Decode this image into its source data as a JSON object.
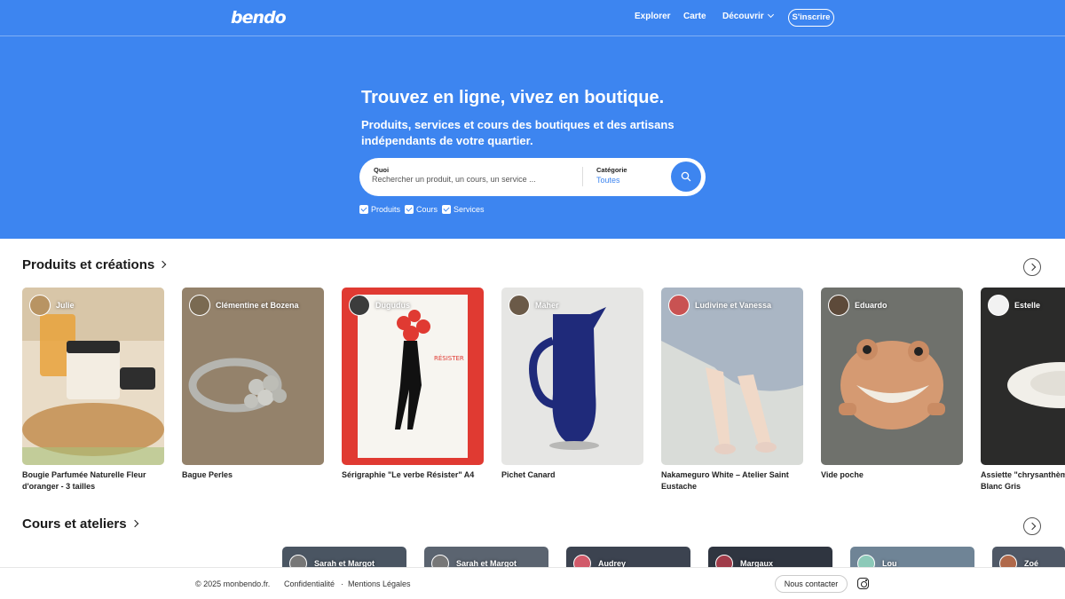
{
  "header": {
    "logo": "bendo",
    "nav": {
      "explorer": "Explorer",
      "carte": "Carte",
      "decouvrir": "Découvrir"
    },
    "signup": "S'inscrire"
  },
  "hero": {
    "title": "Trouvez en ligne, vivez en boutique.",
    "subtitle": "Produits, services et cours des boutiques et des artisans indépendants de votre quartier.",
    "search": {
      "what_label": "Quoi",
      "what_placeholder": "Rechercher un produit, un cours, un service ...",
      "category_label": "Catégorie",
      "category_value": "Toutes"
    },
    "filters": [
      {
        "label": "Produits",
        "checked": true
      },
      {
        "label": "Cours",
        "checked": true
      },
      {
        "label": "Services",
        "checked": true
      }
    ]
  },
  "products": {
    "title": "Produits et créations",
    "items": [
      {
        "seller": "Julie",
        "title": "Bougie Parfumée Naturelle Fleur d'oranger - 3 tailles"
      },
      {
        "seller": "Clémentine et Bozena",
        "title": "Bague Perles"
      },
      {
        "seller": "Dugudus",
        "title": "Sérigraphie \"Le verbe Résister\" A4"
      },
      {
        "seller": "Maher",
        "title": "Pichet Canard"
      },
      {
        "seller": "Ludivine et Vanessa",
        "title": "Nakameguro White – Atelier Saint Eustache"
      },
      {
        "seller": "Eduardo",
        "title": "Vide poche"
      },
      {
        "seller": "Estelle",
        "title": "Assiette \"chrysanthème\" Palace - Blanc Gris"
      }
    ]
  },
  "courses": {
    "title": "Cours et ateliers",
    "items": [
      {
        "seller": "Sarah et Margot"
      },
      {
        "seller": "Sarah et Margot"
      },
      {
        "seller": "Audrey"
      },
      {
        "seller": "Margaux"
      },
      {
        "seller": "Lou"
      },
      {
        "seller": "Zoé"
      }
    ]
  },
  "footer": {
    "copyright": "© 2025 monbendo.fr.",
    "privacy": "Confidentialité",
    "dot": "·",
    "legal": "Mentions Légales",
    "contact": "Nous contacter"
  }
}
